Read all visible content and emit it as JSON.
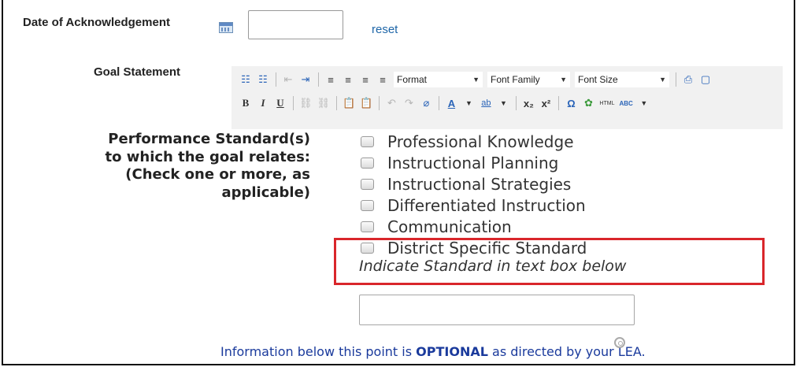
{
  "ack": {
    "label": "Date of Acknowledgement",
    "date_value": "",
    "reset_label": "reset"
  },
  "goal": {
    "label": "Goal Statement",
    "toolbar": {
      "row1_buttons": [
        "☷",
        "☷",
        "⇤",
        "⇥",
        "≡",
        "≡",
        "≡",
        "≡"
      ],
      "format_label": "Format",
      "font_family_label": "Font Family",
      "font_size_label": "Font Size",
      "row1_tail": [
        "⎙",
        "▢"
      ],
      "row2_buttons": [
        "B",
        "I",
        "U"
      ],
      "row2_link_buttons": [
        "⛓",
        "⛓"
      ],
      "row2_paste_buttons": [
        "📋",
        "📋"
      ],
      "row2_undo_buttons": [
        "↶",
        "↷",
        "⌀"
      ],
      "row2_color_buttons": [
        "A",
        "ab"
      ],
      "row2_script_buttons": [
        "x₂",
        "x²"
      ],
      "row2_insert_buttons": [
        "Ω",
        "✿",
        "HTML",
        "ABC"
      ]
    }
  },
  "perf": {
    "label_lines": [
      "Performance Standard(s)",
      "to which the goal relates:",
      "(Check one or more, as",
      "applicable)"
    ],
    "options": [
      {
        "label": "Professional Knowledge",
        "checked": false
      },
      {
        "label": "Instructional Planning",
        "checked": false
      },
      {
        "label": "Instructional Strategies",
        "checked": false
      },
      {
        "label": "Differentiated Instruction",
        "checked": false
      },
      {
        "label": "Communication",
        "checked": false
      },
      {
        "label": "District Specific Standard",
        "checked": false
      }
    ],
    "indicate_text": "Indicate Standard in text box below",
    "district_standard_value": ""
  },
  "note": {
    "before": "Information below this point is ",
    "emphasis": "OPTIONAL",
    "after": " as directed by your LEA."
  },
  "colors": {
    "link": "#1e66a8",
    "note": "#1a3a9c",
    "highlight_border": "#d9262b",
    "toolbar_bg": "#f1f1f1"
  },
  "icons": {
    "calendar": "calendar-icon",
    "cursor": "busy-cursor-icon"
  }
}
